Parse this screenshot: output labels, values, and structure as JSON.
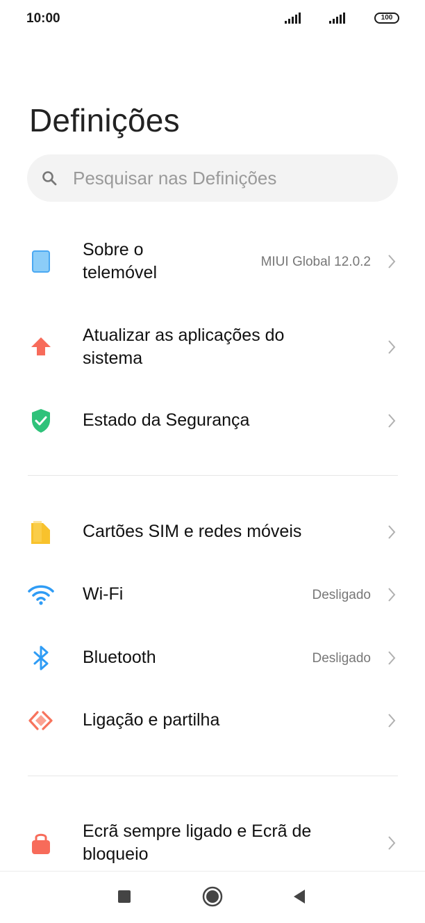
{
  "status_bar": {
    "time": "10:00",
    "battery": "100"
  },
  "page": {
    "title": "Definições"
  },
  "search": {
    "placeholder": "Pesquisar nas Definições"
  },
  "settings": [
    {
      "label_line1": "Sobre o",
      "label_line2": "telemóvel",
      "value": "MIUI Global 12.0.2",
      "icon": "phone-icon",
      "color": "#4aa8f2"
    },
    {
      "label_line1": "Atualizar as aplicações do",
      "label_line2": "sistema",
      "value": "",
      "icon": "update-arrow-icon",
      "color": "#f76b5a"
    },
    {
      "label_line1": "Estado da Segurança",
      "value": "",
      "icon": "shield-icon",
      "color": "#2fc27a"
    },
    {
      "label_line1": "Cartões SIM e redes móveis",
      "value": "",
      "icon": "sim-card-icon",
      "color": "#f8c22c"
    },
    {
      "label_line1": "Wi-Fi",
      "value": "Desligado",
      "icon": "wifi-icon",
      "color": "#2f9cf5"
    },
    {
      "label_line1": "Bluetooth",
      "value": "Desligado",
      "icon": "bluetooth-icon",
      "color": "#2f9cf5"
    },
    {
      "label_line1": "Ligação e partilha",
      "value": "",
      "icon": "connection-sharing-icon",
      "color": "#f7735c"
    },
    {
      "label_line1": "Ecrã sempre ligado e Ecrã de",
      "label_line2": "bloqueio",
      "value": "",
      "icon": "lock-icon",
      "color": "#f76b5a"
    }
  ],
  "nav_bar": {
    "buttons": [
      "recents-button",
      "home-button",
      "back-button"
    ]
  }
}
